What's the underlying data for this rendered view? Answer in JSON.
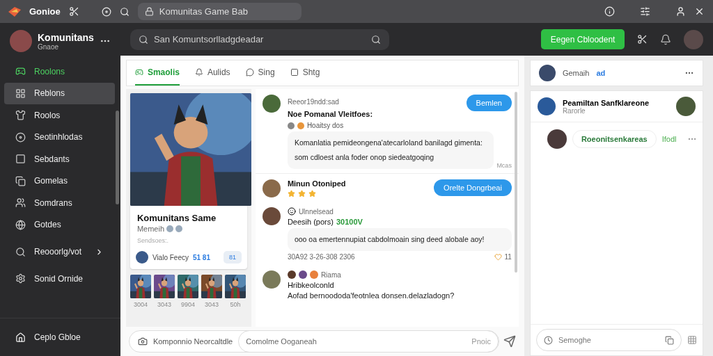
{
  "titlebar": {
    "app_name": "Gonioe",
    "address": "Komunitas Game Bab"
  },
  "sidebar": {
    "profile": {
      "name": "Komunitans",
      "status": "Gnaoe"
    },
    "items": [
      {
        "label": "Roolons",
        "kind": "featured",
        "selected": false
      },
      {
        "label": "Reblons",
        "kind": "plain",
        "selected": true
      },
      {
        "label": "Roolos",
        "kind": "plain",
        "selected": false
      },
      {
        "label": "Seotinhlodas",
        "kind": "plain",
        "selected": false
      },
      {
        "label": "Sebdants",
        "kind": "plain",
        "selected": false
      },
      {
        "label": "Gomelas",
        "kind": "plain",
        "selected": false
      },
      {
        "label": "Somdrans",
        "kind": "plain",
        "selected": false
      },
      {
        "label": "Gotdes",
        "kind": "plain",
        "selected": false
      },
      {
        "label": "Reooorlg/vot",
        "kind": "submenu",
        "selected": false
      },
      {
        "label": "Sonid Ornide",
        "kind": "plain",
        "selected": false
      }
    ],
    "footer": "Ceplo Gbloe"
  },
  "header": {
    "search_placeholder": "San Komuntsorlladgdeadar",
    "primary_button": "Eegen Cbloodent"
  },
  "tabs": [
    {
      "label": "Smaolis",
      "selected": true
    },
    {
      "label": "Aulids",
      "selected": false
    },
    {
      "label": "Sing",
      "selected": false
    },
    {
      "label": "Shtg",
      "selected": false
    }
  ],
  "game_card": {
    "kind": "picture",
    "title": "Komunitans Same",
    "subtitle": "Memeih",
    "meta": "Sendsoes:.",
    "player": "Vialo Feecy",
    "player_score": "51 81",
    "action": "81",
    "thumbnails": [
      {
        "caption": "3004"
      },
      {
        "caption": "3043"
      },
      {
        "caption": "9904"
      },
      {
        "caption": "3043"
      },
      {
        "caption": "50h"
      }
    ]
  },
  "feed": [
    {
      "kind": "post",
      "meta": "Reeor19ndd:sad",
      "title": "Noe Pomanal Vleitfoes:",
      "sub": "Hoaitsy dos",
      "button": "Bemlen",
      "body": "Komanlatia pemideongena'atecarloland banilagd gimenta: som cdloest anla foder onop siedeatgoqing",
      "more": "Mcas"
    },
    {
      "kind": "rated",
      "title": "Minun Otoniped",
      "stars": 3,
      "button": "Orelte Dongrbeai"
    },
    {
      "kind": "comment",
      "meta": "Ulnnelsead",
      "title": "Deesih (pors)",
      "tag": "30100V",
      "body": "ooo oa emertennupiat cabdolmoain sing deed alobale aoy!",
      "time": "30A92 3-26-308 2306",
      "count": "11"
    },
    {
      "kind": "thread",
      "meta": "Riama",
      "title": "Hribkeolconld",
      "body": "Aofad bernoododa'feotnlea donsen.delazladogn?"
    }
  ],
  "comment_bar": {
    "label": "Komponnio Neorcaltdle",
    "placeholder": "Comolme Ooganeah",
    "action": "Pnoic"
  },
  "right_panel": {
    "header": {
      "name": "Gemaih",
      "badge": "ad"
    },
    "chat": {
      "title": "Peamiltan Sanfklareone",
      "subtitle": "Rarorle"
    },
    "entries": [
      {
        "label": "Roeonitsenkareas",
        "action": "Ifodl"
      }
    ],
    "input_placeholder": "Semoghe"
  }
}
